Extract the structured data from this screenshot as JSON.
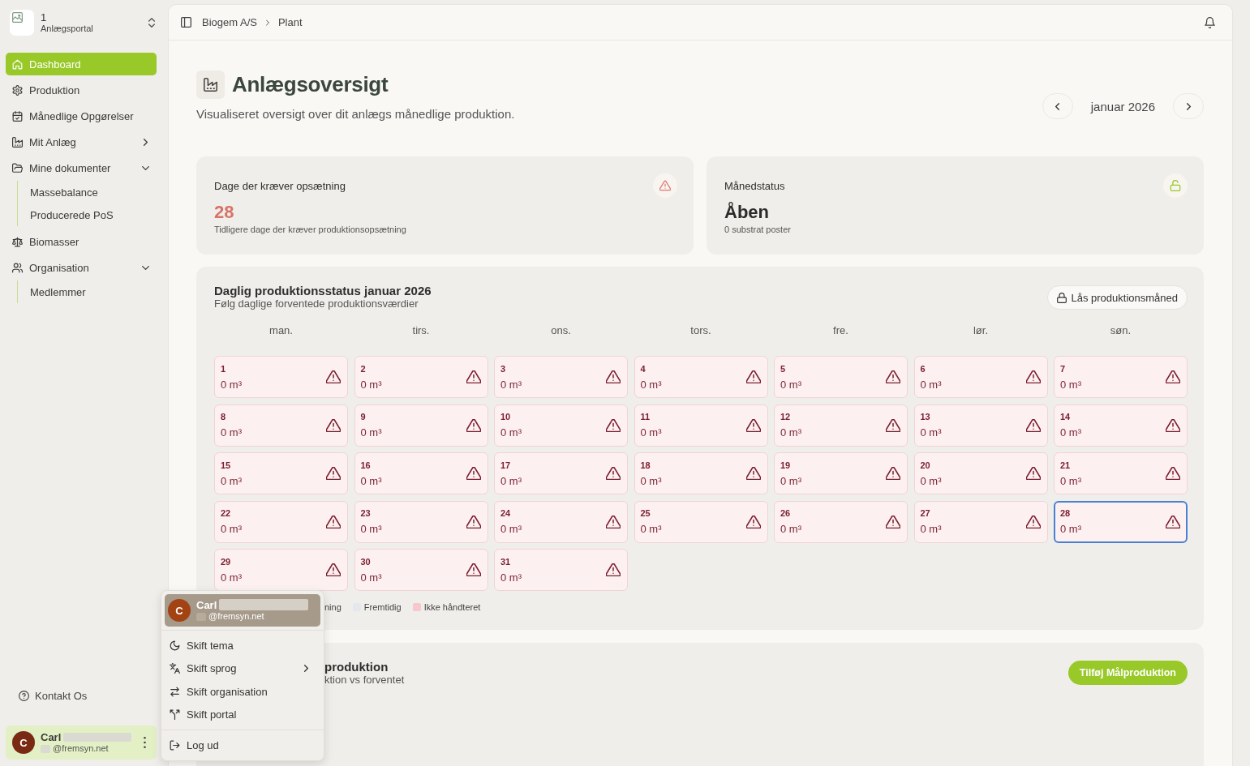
{
  "sidebar": {
    "portal": {
      "number": "1",
      "name": "Anlægsportal"
    },
    "nav": [
      {
        "label": "Dashboard",
        "kind": "link",
        "selected": true
      },
      {
        "label": "Produktion",
        "kind": "link",
        "selected": false
      },
      {
        "label": "Månedlige Opgørelser",
        "kind": "link",
        "selected": false
      },
      {
        "label": "Mit Anlæg",
        "kind": "group",
        "selected": false,
        "expanded": false
      },
      {
        "label": "Mine dokumenter",
        "kind": "group",
        "selected": false,
        "expanded": true,
        "children": [
          {
            "label": "Massebalance",
            "selected": false
          },
          {
            "label": "Producerede PoS",
            "selected": false
          }
        ]
      },
      {
        "label": "Biomasser",
        "kind": "link",
        "selected": false
      },
      {
        "label": "Organisation",
        "kind": "group",
        "selected": false,
        "expanded": true,
        "children": [
          {
            "label": "Medlemmer",
            "selected": false
          }
        ]
      }
    ],
    "contact": "Kontakt Os",
    "user": {
      "initial": "C",
      "name": "Carl",
      "email": "@fremsyn.net"
    }
  },
  "header": {
    "breadcrumbs": [
      "Biogem A/S",
      "Plant"
    ]
  },
  "page": {
    "title": "Anlægsoversigt",
    "subtitle": "Visualiseret oversigt over dit anlægs månedlige produktion.",
    "month": "januar 2026"
  },
  "stat_cards": [
    {
      "kind": "warning",
      "title": "Dage der kræver opsætning",
      "value": "28",
      "note": "Tidligere dage der kræver produktionsopsætning"
    },
    {
      "kind": "unlocked",
      "title": "Månedstatus",
      "value": "Åben",
      "note": "0 substrat poster"
    }
  ],
  "calendar": {
    "title": "Daglig produktionsstatus januar 2026",
    "subtitle": "Følg daglige forventede produktionsværdier",
    "lock_button": "Lås produktionsmåned",
    "weekdays": [
      "man.",
      "tirs.",
      "ons.",
      "tors.",
      "fre.",
      "lør.",
      "søn."
    ],
    "days": [
      {
        "day": "1",
        "amount": "0 m³",
        "unhandled": true,
        "selected": false
      },
      {
        "day": "2",
        "amount": "0 m³",
        "unhandled": true,
        "selected": false
      },
      {
        "day": "3",
        "amount": "0 m³",
        "unhandled": true,
        "selected": false
      },
      {
        "day": "4",
        "amount": "0 m³",
        "unhandled": true,
        "selected": false
      },
      {
        "day": "5",
        "amount": "0 m³",
        "unhandled": true,
        "selected": false
      },
      {
        "day": "6",
        "amount": "0 m³",
        "unhandled": true,
        "selected": false
      },
      {
        "day": "7",
        "amount": "0 m³",
        "unhandled": true,
        "selected": false
      },
      {
        "day": "8",
        "amount": "0 m³",
        "unhandled": true,
        "selected": false
      },
      {
        "day": "9",
        "amount": "0 m³",
        "unhandled": true,
        "selected": false
      },
      {
        "day": "10",
        "amount": "0 m³",
        "unhandled": true,
        "selected": false
      },
      {
        "day": "11",
        "amount": "0 m³",
        "unhandled": true,
        "selected": false
      },
      {
        "day": "12",
        "amount": "0 m³",
        "unhandled": true,
        "selected": false
      },
      {
        "day": "13",
        "amount": "0 m³",
        "unhandled": true,
        "selected": false
      },
      {
        "day": "14",
        "amount": "0 m³",
        "unhandled": true,
        "selected": false
      },
      {
        "day": "15",
        "amount": "0 m³",
        "unhandled": true,
        "selected": false
      },
      {
        "day": "16",
        "amount": "0 m³",
        "unhandled": true,
        "selected": false
      },
      {
        "day": "17",
        "amount": "0 m³",
        "unhandled": true,
        "selected": false
      },
      {
        "day": "18",
        "amount": "0 m³",
        "unhandled": true,
        "selected": false
      },
      {
        "day": "19",
        "amount": "0 m³",
        "unhandled": true,
        "selected": false
      },
      {
        "day": "20",
        "amount": "0 m³",
        "unhandled": true,
        "selected": false
      },
      {
        "day": "21",
        "amount": "0 m³",
        "unhandled": true,
        "selected": false
      },
      {
        "day": "22",
        "amount": "0 m³",
        "unhandled": true,
        "selected": false
      },
      {
        "day": "23",
        "amount": "0 m³",
        "unhandled": true,
        "selected": false
      },
      {
        "day": "24",
        "amount": "0 m³",
        "unhandled": true,
        "selected": false
      },
      {
        "day": "25",
        "amount": "0 m³",
        "unhandled": true,
        "selected": false
      },
      {
        "day": "26",
        "amount": "0 m³",
        "unhandled": true,
        "selected": false
      },
      {
        "day": "27",
        "amount": "0 m³",
        "unhandled": true,
        "selected": false
      },
      {
        "day": "28",
        "amount": "0 m³",
        "unhandled": true,
        "selected": true
      },
      {
        "day": "29",
        "amount": "0 m³",
        "unhandled": true,
        "selected": false
      },
      {
        "day": "30",
        "amount": "0 m³",
        "unhandled": true,
        "selected": false
      },
      {
        "day": "31",
        "amount": "0 m³",
        "unhandled": true,
        "selected": false
      }
    ],
    "legend": [
      {
        "label": "ning"
      },
      {
        "label": "Fremtidig",
        "color": "#e4e8ee"
      },
      {
        "label": "Ikke håndteret",
        "color": "#f8c6cd"
      }
    ]
  },
  "target_panel": {
    "title": "produktion",
    "subtitle": "ktion vs forventet",
    "button": "Tilføj Målproduktion"
  },
  "user_menu": {
    "header": {
      "initial": "C",
      "name": "Carl",
      "email": "@fremsyn.net",
      "hovered": true
    },
    "items": [
      {
        "label": "Skift tema",
        "kind": "action"
      },
      {
        "label": "Skift sprog",
        "kind": "submenu"
      },
      {
        "label": "Skift organisation",
        "kind": "action"
      },
      {
        "label": "Skift portal",
        "kind": "action"
      },
      {
        "label": "Log ud",
        "kind": "logout"
      }
    ]
  }
}
